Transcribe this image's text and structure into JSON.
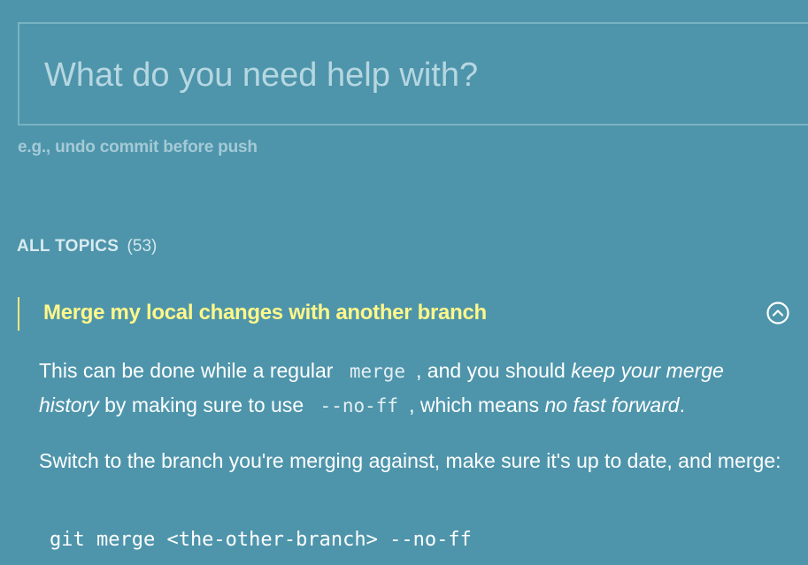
{
  "search": {
    "placeholder": "What do you need help with?",
    "hint": "e.g., undo commit before push"
  },
  "topics": {
    "label": "ALL TOPICS",
    "count": "(53)"
  },
  "topic": {
    "title": "Merge my local changes with another branch",
    "icon": "chevron-up-circle",
    "p1": {
      "t1": "This can be done while a regular",
      "code1": "merge",
      "t2": ", and you should",
      "em1": "keep your merge history",
      "t3": "by making sure to use",
      "code2": "--no-ff",
      "t4": ", which means",
      "em2": "no fast forward",
      "t5": "."
    },
    "p2": "Switch to the branch you're merging against, make sure it's up to date, and merge:",
    "code": "git merge <the-other-branch> --no-ff"
  },
  "colors": {
    "background": "#4e95ab",
    "title": "#fff78a",
    "accent_border": "#f5e87a"
  }
}
